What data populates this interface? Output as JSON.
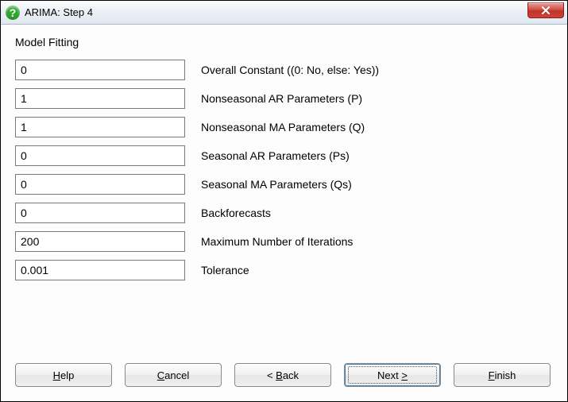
{
  "window": {
    "title": "ARIMA: Step 4"
  },
  "section": {
    "title": "Model Fitting"
  },
  "fields": {
    "constant": {
      "value": "0",
      "label": "Overall Constant ((0: No, else: Yes))"
    },
    "ar_p": {
      "value": "1",
      "label": "Nonseasonal AR Parameters (P)"
    },
    "ma_q": {
      "value": "1",
      "label": "Nonseasonal MA Parameters (Q)"
    },
    "sar_ps": {
      "value": "0",
      "label": "Seasonal AR Parameters (Ps)"
    },
    "sma_qs": {
      "value": "0",
      "label": "Seasonal MA Parameters (Qs)"
    },
    "backforecasts": {
      "value": "0",
      "label": "Backforecasts"
    },
    "max_iter": {
      "value": "200",
      "label": "Maximum Number of Iterations"
    },
    "tolerance": {
      "value": "0.001",
      "label": "Tolerance"
    }
  },
  "buttons": {
    "help": {
      "mnemonic": "H",
      "rest": "elp"
    },
    "cancel": {
      "mnemonic": "C",
      "rest": "ancel"
    },
    "back": {
      "prefix": "< ",
      "mnemonic": "B",
      "rest": "ack"
    },
    "next": {
      "pre": "Next ",
      "mnemonic": ">",
      "rest": ""
    },
    "finish": {
      "mnemonic": "F",
      "rest": "inish"
    }
  }
}
